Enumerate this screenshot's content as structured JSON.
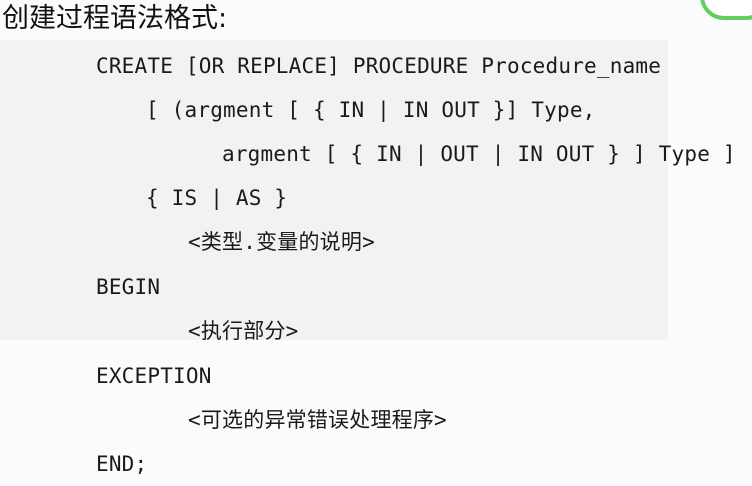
{
  "title": "创建过程语法格式:",
  "code": {
    "line1": "CREATE [OR REPLACE] PROCEDURE Procedure_name",
    "line2": "[ (argment [ { IN | IN OUT }] Type,",
    "line3": "argment [ { IN | OUT | IN OUT } ] Type ]",
    "line4": "{ IS | AS }",
    "line5": "<类型.变量的说明>",
    "line6": "BEGIN",
    "line7": "<执行部分>",
    "line8": "EXCEPTION",
    "line9": "<可选的异常错误处理程序>",
    "line10": "END;"
  },
  "colors": {
    "panel_background": "#f2f2f2",
    "page_background": "#fbfbfb",
    "widget_border": "#5fd05f"
  }
}
